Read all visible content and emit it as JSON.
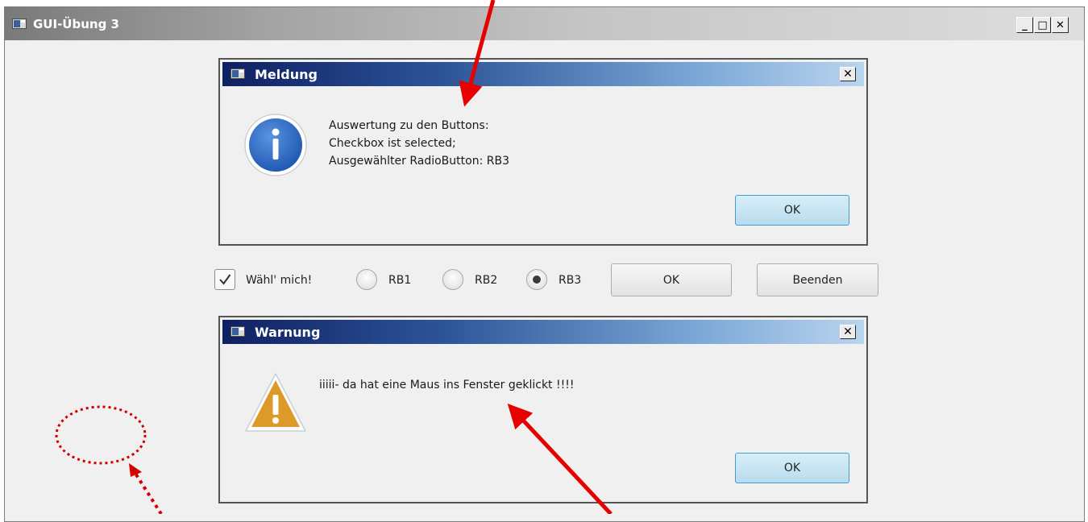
{
  "window": {
    "title": "GUI-Übung 3",
    "minimize_glyph": "_",
    "maximize_glyph": "□",
    "close_glyph": "✕"
  },
  "dialog_info": {
    "title": "Meldung",
    "icon": "info-icon",
    "lines": [
      "Auswertung zu den Buttons:",
      "Checkbox ist selected;",
      "Ausgewählter RadioButton: RB3"
    ],
    "ok_label": "OK",
    "close_glyph": "✕"
  },
  "controls": {
    "checkbox_label": "Wähl' mich!",
    "checkbox_checked": true,
    "radios": [
      {
        "label": "RB1",
        "selected": false
      },
      {
        "label": "RB2",
        "selected": false
      },
      {
        "label": "RB3",
        "selected": true
      }
    ],
    "ok_label": "OK",
    "quit_label": "Beenden"
  },
  "dialog_warning": {
    "title": "Warnung",
    "icon": "warning-icon",
    "message": "iiiii- da hat eine Maus ins Fenster geklickt !!!!",
    "ok_label": "OK",
    "close_glyph": "✕"
  },
  "annotations": {
    "arrow_color": "#e60000",
    "marker_shape": "dotted-circle"
  }
}
